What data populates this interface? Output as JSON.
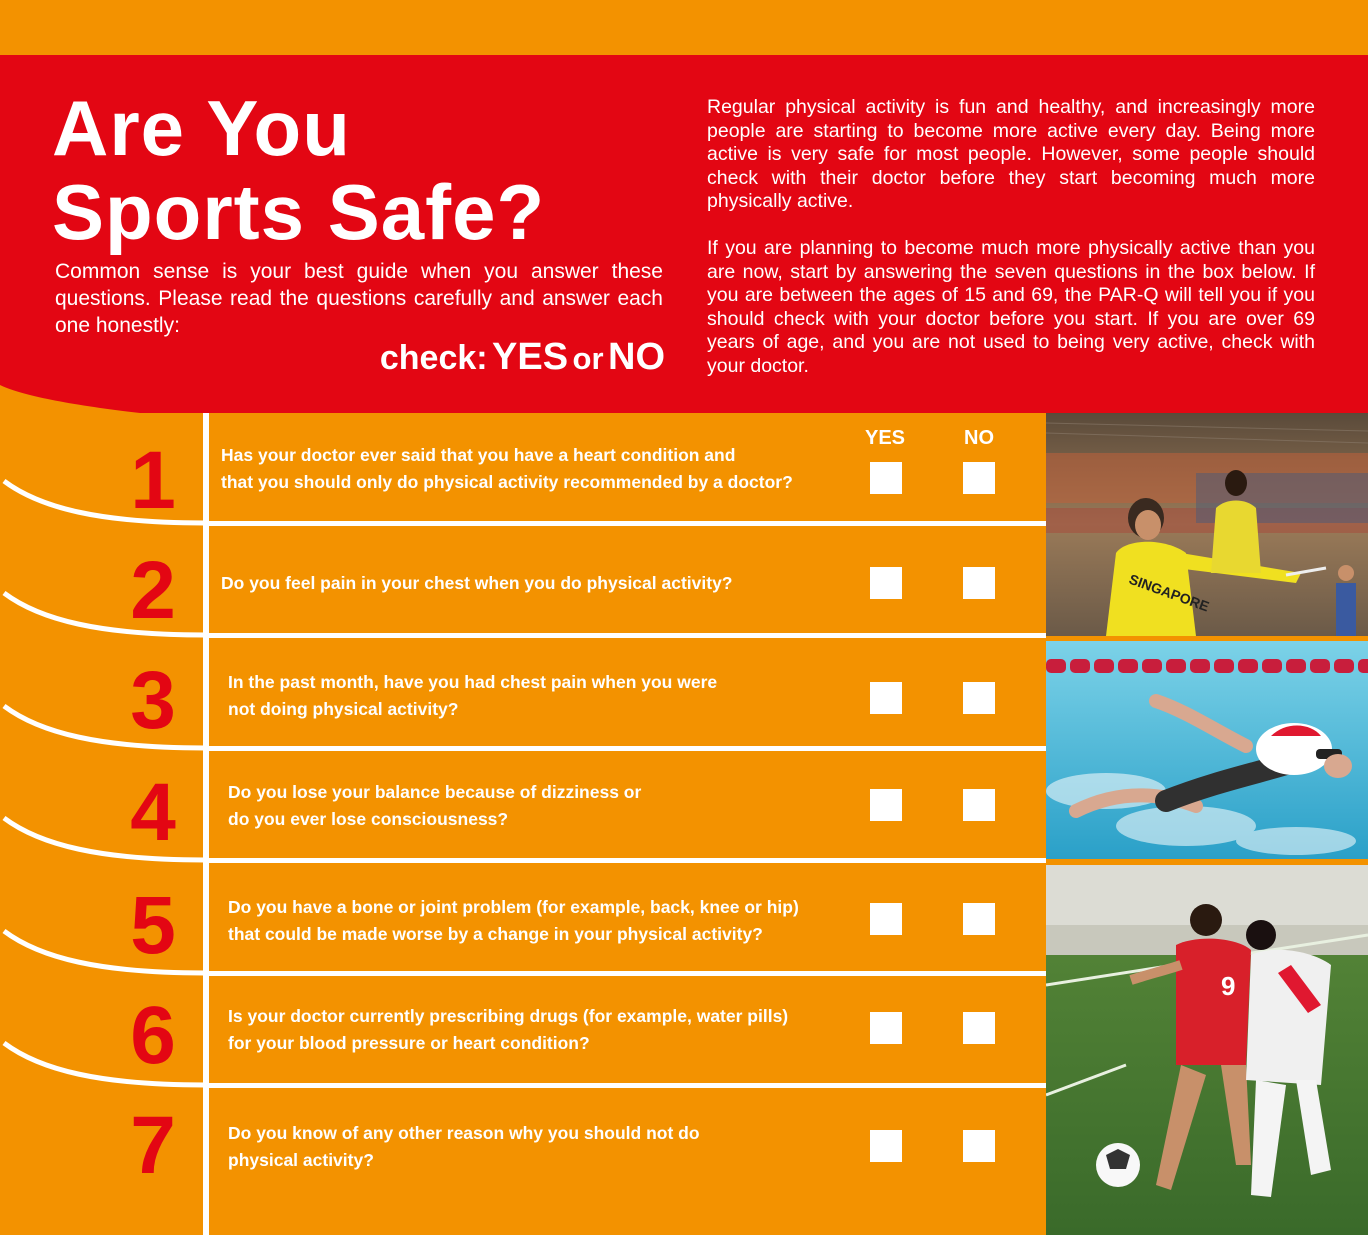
{
  "header": {
    "title_line1": "Are You",
    "title_line2": "Sports Safe?",
    "intro": "Common sense is your best guide when you answer these questions. Please read the questions carefully and answer each one honestly:",
    "check_prefix": "check:",
    "check_yes": "YES",
    "check_or": "or",
    "check_no": "NO",
    "description_p1": "Regular physical activity is fun and healthy, and increasingly more people are starting to become more active every day. Being more active is very safe for most people. However, some people should check with their doctor before they start becoming much more physically active.",
    "description_p2": "If you are planning to become much more physically active than you are now, start by answering the seven questions in the box below. If you are between the ages of 15 and 69, the PAR-Q will tell you if you should check with your doctor before you start. If you are over 69 years of age, and you are not used to being very active, check with your doctor."
  },
  "columns": {
    "yes": "YES",
    "no": "NO"
  },
  "questions": [
    {
      "number": "1",
      "line1": "Has your doctor ever said that you have a heart condition and",
      "line2": "that you should only do physical activity recommended by a doctor?"
    },
    {
      "number": "2",
      "line1": "Do you feel pain in your chest when you do physical activity?",
      "line2": ""
    },
    {
      "number": "3",
      "line1": "In the past month, have you had chest pain when you were",
      "line2": "not doing physical activity?"
    },
    {
      "number": "4",
      "line1": "Do you lose your balance because of dizziness or",
      "line2": "do you ever lose consciousness?"
    },
    {
      "number": "5",
      "line1": "Do you have a bone or joint problem (for example, back, knee or hip)",
      "line2": "that could be made worse by a change in your physical activity?"
    },
    {
      "number": "6",
      "line1": "Is your doctor currently prescribing drugs (for example, water pills)",
      "line2": "for your blood pressure or heart condition?"
    },
    {
      "number": "7",
      "line1": "Do you know of any other reason why you should not do",
      "line2": "physical activity?"
    }
  ],
  "colors": {
    "orange": "#f39200",
    "red": "#e30613",
    "white": "#ffffff"
  },
  "photos": [
    {
      "name": "badminton-photo"
    },
    {
      "name": "swimming-photo"
    },
    {
      "name": "soccer-photo"
    }
  ]
}
